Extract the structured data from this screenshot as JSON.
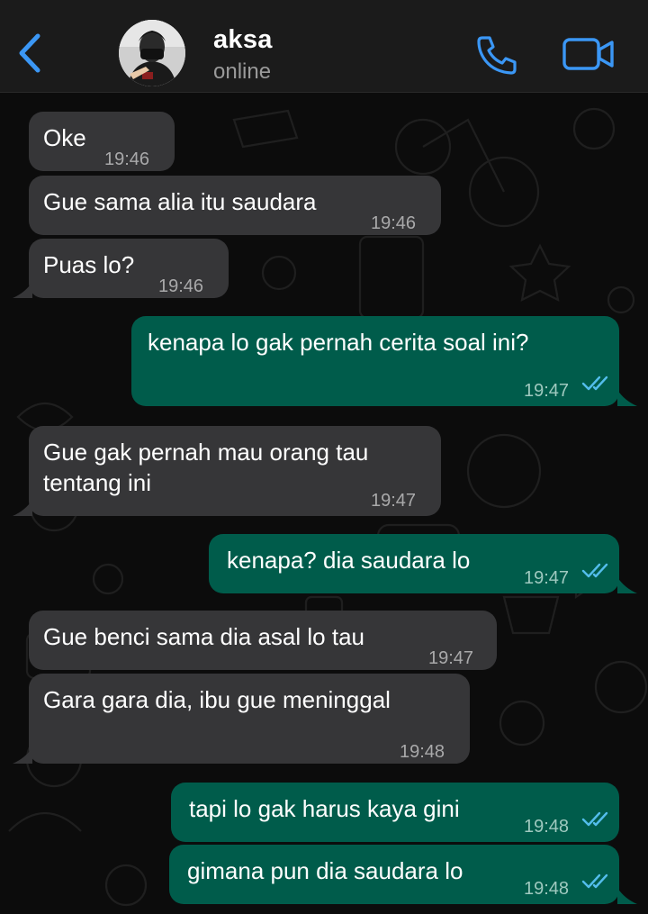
{
  "header": {
    "contact_name": "aksa",
    "status": "online",
    "back_icon": "chevron-left-icon",
    "call_icon": "phone-icon",
    "video_icon": "video-camera-icon"
  },
  "colors": {
    "accent": "#3b97f5",
    "incoming_bubble": "#363638",
    "outgoing_bubble": "#005c4b",
    "read_tick": "#53bdeb"
  },
  "messages": [
    {
      "direction": "in",
      "text": "Oke",
      "time": "19:46"
    },
    {
      "direction": "in",
      "text": "Gue sama alia itu saudara",
      "time": "19:46"
    },
    {
      "direction": "in",
      "text": "Puas lo?",
      "time": "19:46"
    },
    {
      "direction": "out",
      "text": "kenapa lo gak pernah cerita soal ini?",
      "time": "19:47",
      "status": "read"
    },
    {
      "direction": "in",
      "text": "Gue gak pernah mau orang tau tentang ini",
      "time": "19:47"
    },
    {
      "direction": "out",
      "text": "kenapa? dia saudara lo",
      "time": "19:47",
      "status": "read"
    },
    {
      "direction": "in",
      "text": "Gue benci sama dia asal lo tau",
      "time": "19:47"
    },
    {
      "direction": "in",
      "text": "Gara gara dia, ibu gue meninggal",
      "time": "19:48"
    },
    {
      "direction": "out",
      "text": "tapi lo gak harus kaya gini",
      "time": "19:48",
      "status": "read"
    },
    {
      "direction": "out",
      "text": "gimana pun dia saudara lo",
      "time": "19:48",
      "status": "read"
    }
  ]
}
